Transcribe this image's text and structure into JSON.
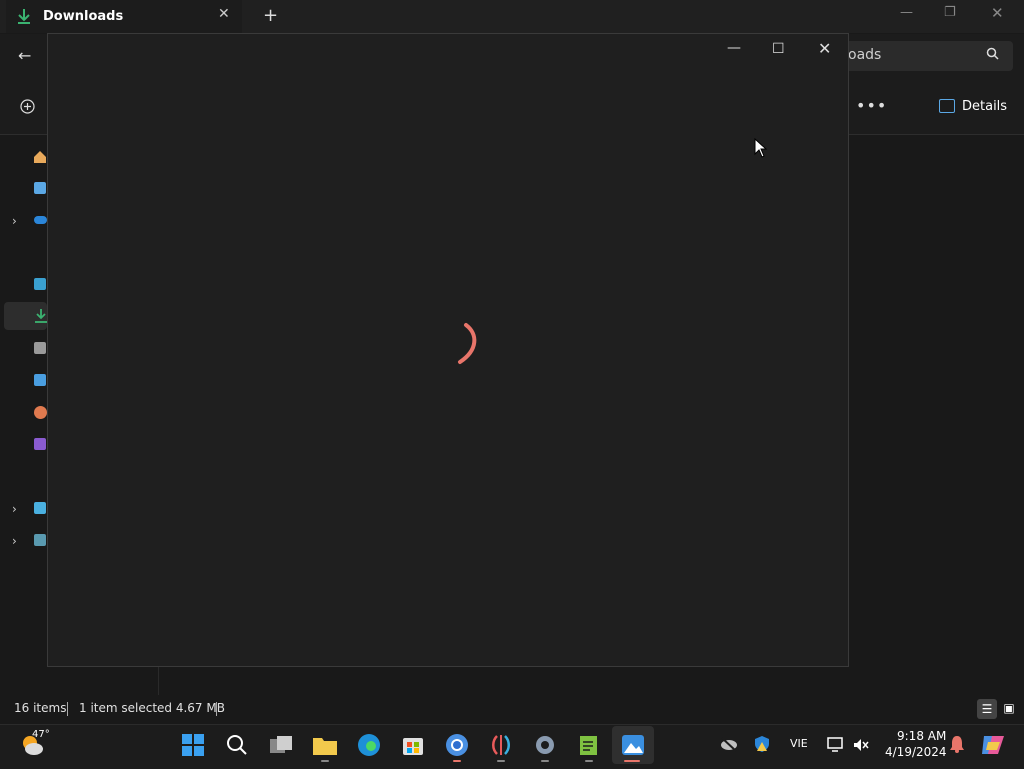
{
  "explorer": {
    "tab_title": "Downloads",
    "tab_close": "✕",
    "new_tab": "+",
    "window_min": "—",
    "window_max": "❐",
    "window_close": "✕",
    "back": "←",
    "search_visible_text": "oads",
    "more": "•••",
    "details_label": "Details",
    "status": {
      "item_count": "16 items",
      "selection": "1 item selected  4.67 MB"
    }
  },
  "app_window": {
    "min": "—",
    "max": "☐",
    "close": "✕"
  },
  "taskbar": {
    "weather_temp": "47°",
    "language": "VIE",
    "time": "9:18 AM",
    "date": "4/19/2024"
  },
  "colors": {
    "spinner": "#e8756a",
    "accent": "#5ba8e5",
    "download_green": "#3bb371"
  }
}
